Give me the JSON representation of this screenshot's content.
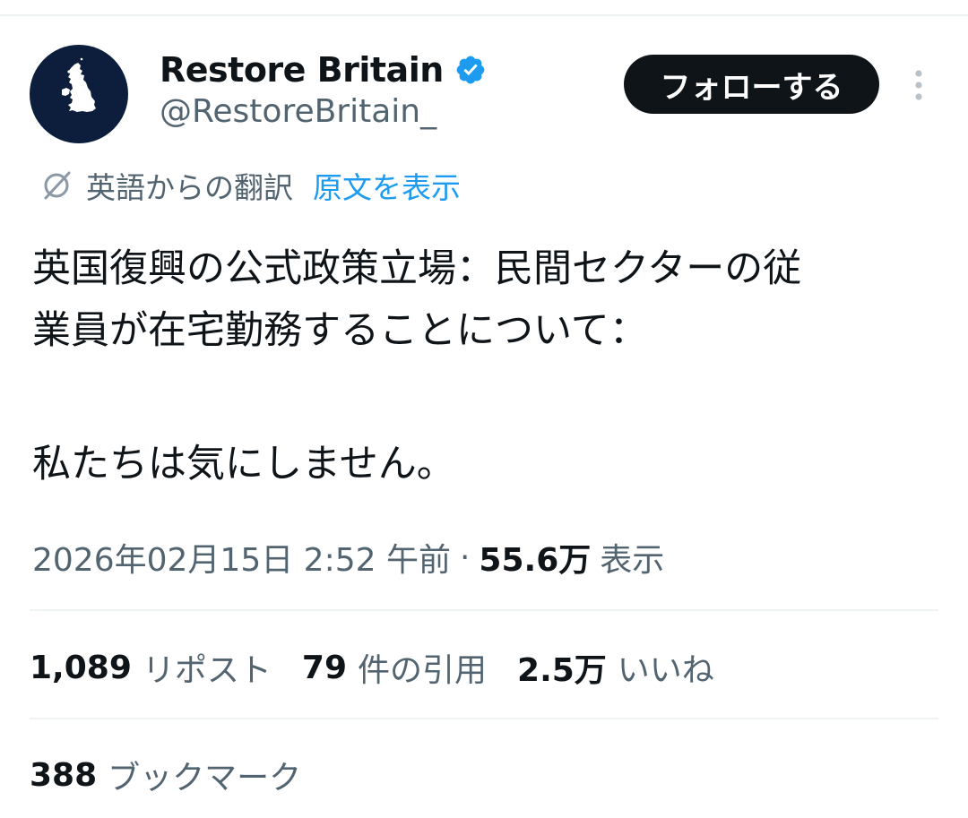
{
  "author": {
    "display_name": "Restore Britain",
    "handle": "@RestoreBritain_",
    "verified_color": "#1d9bf0",
    "avatar_bg": "#0c1e3c",
    "avatar_icon": "uk-map-icon"
  },
  "header": {
    "follow_label": "フォローする",
    "more_icon": "more-vertical-icon"
  },
  "translation": {
    "icon": "translate-icon",
    "label": "英語からの翻訳",
    "show_original_label": "原文を表示"
  },
  "tweet": {
    "lines": [
      "英国復興の公式政策立場：民間セクターの従",
      "業員が在宅勤務することについて：",
      "私たちは気にしません。"
    ]
  },
  "meta": {
    "timestamp": "2026年02月15日 2:52 午前",
    "separator": "·",
    "views_count": "55.6万",
    "views_label": "表示"
  },
  "stats": {
    "reposts_count": "1,089",
    "reposts_label": "リポスト",
    "quotes_count": "79",
    "quotes_label": "件の引用",
    "likes_count": "2.5万",
    "likes_label": "いいね",
    "bookmarks_count": "388",
    "bookmarks_label": "ブックマーク"
  },
  "colors": {
    "text_primary": "#0f1419",
    "text_secondary": "#536471",
    "link": "#1d9bf0",
    "divider": "#eff3f4"
  }
}
